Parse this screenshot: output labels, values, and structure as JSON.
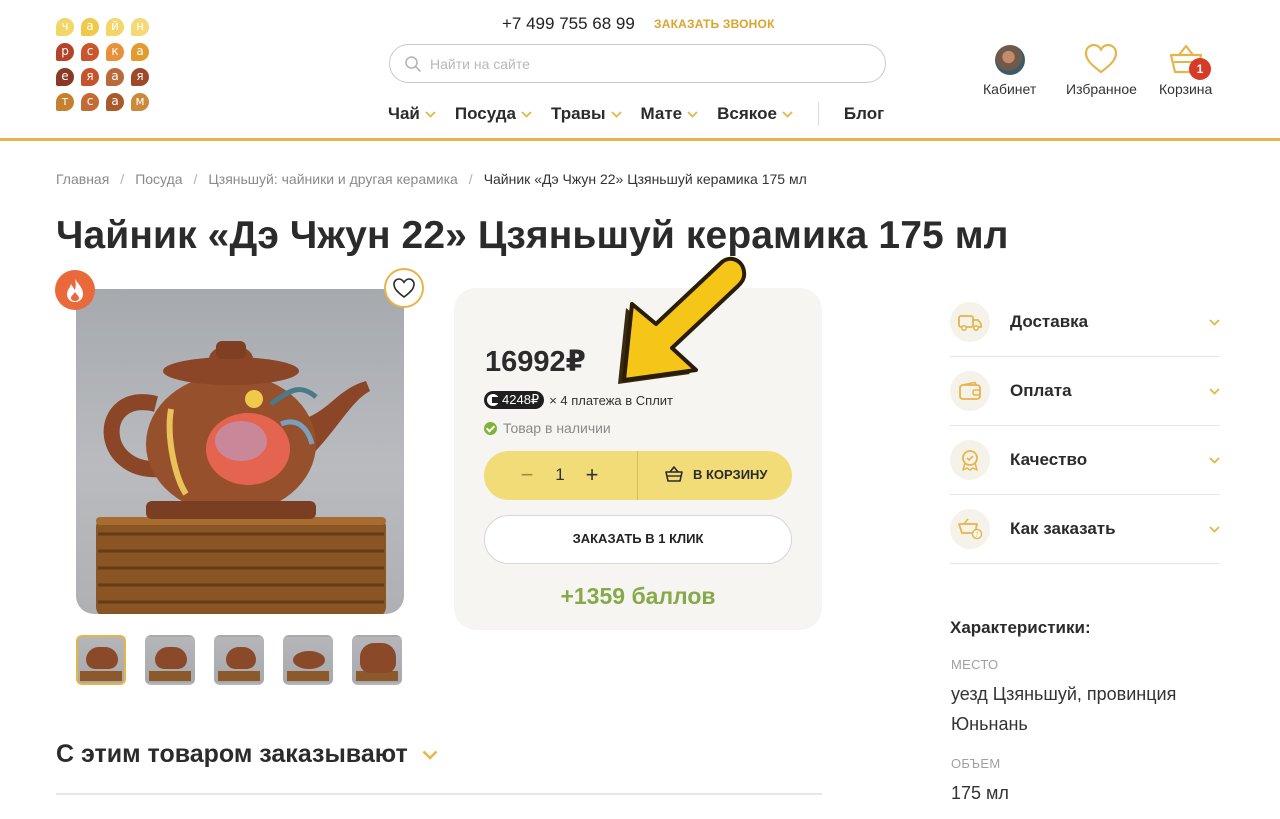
{
  "logo": {
    "letters": [
      "ч",
      "а",
      "й",
      "н",
      "р",
      "с",
      "к",
      "а",
      "е",
      "я",
      "а",
      "я",
      "т",
      "с",
      "а",
      "м"
    ],
    "colors": [
      "#f2d66a",
      "#f0c84a",
      "#f2d66a",
      "#f5d978",
      "#b4432a",
      "#c9562c",
      "#e8903a",
      "#e39b2f",
      "#8a3a24",
      "#c4542c",
      "#b86a3a",
      "#9c4a2a",
      "#c7802f",
      "#c46a34",
      "#a85a2c",
      "#c98a3c"
    ]
  },
  "header": {
    "phone": "+7 499 755 68 99",
    "callback": "ЗАКАЗАТЬ ЗВОНОК",
    "search_placeholder": "Найти на сайте",
    "nav": [
      {
        "label": "Чай"
      },
      {
        "label": "Посуда"
      },
      {
        "label": "Травы"
      },
      {
        "label": "Мате"
      },
      {
        "label": "Всякое"
      }
    ],
    "blog": "Блог",
    "cabinet": "Кабинет",
    "favorites": "Избранное",
    "cart": "Корзина",
    "cart_count": "1"
  },
  "breadcrumb": [
    "Главная",
    "Посуда",
    "Цзяньшуй: чайники и другая керамика",
    "Чайник «Дэ Чжун 22» Цзяньшуй керамика 175 мл"
  ],
  "product": {
    "title": "Чайник «Дэ Чжун 22» Цзяньшуй керамика 175 мл",
    "price": "16992₽",
    "split_amount": "4248₽",
    "split_text": "× 4 платежа в Сплит",
    "stock": "Товар в наличии",
    "qty": "1",
    "qty_minus": "−",
    "qty_plus": "+",
    "add_to_cart": "В КОРЗИНУ",
    "one_click": "ЗАКАЗАТЬ В 1 КЛИК",
    "bonus": "+1359 баллов"
  },
  "accordion": [
    "Доставка",
    "Оплата",
    "Качество",
    "Как заказать"
  ],
  "characteristics": {
    "title": "Характеристики:",
    "place_key": "МЕСТО",
    "place_value": "уезд Цзяньшуй, провинция Юньнань",
    "volume_key": "ОБЪЕМ",
    "volume_value": "175 мл"
  },
  "also_ordered": "С этим товаром заказывают",
  "colors": {
    "accent": "#e6b54a",
    "cart_button": "#f2dc78",
    "bonus_green": "#86a94a",
    "badge_red": "#d73a25",
    "arrow_yellow": "#f5c518"
  }
}
